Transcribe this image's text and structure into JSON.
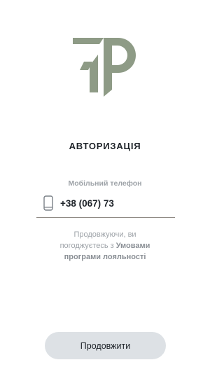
{
  "brand": {
    "logo_color": "#8e9b86",
    "logo_accent_color": "#a7b0a0"
  },
  "auth": {
    "title": "АВТОРИЗАЦІЯ",
    "phone": {
      "label": "Мобільний телефон",
      "value": "+38 (067) 73",
      "icon": "mobile-phone-icon"
    },
    "consent": {
      "text_before": "Продовжуючи, ви погоджуєтесь з",
      "link_text": "Умовами програми лояльності"
    },
    "continue_label": "Продовжити"
  },
  "colors": {
    "button_background": "#dde1e5",
    "text_primary": "#1e2329",
    "text_muted": "#9ea3a8",
    "underline": "#8f8a84"
  }
}
